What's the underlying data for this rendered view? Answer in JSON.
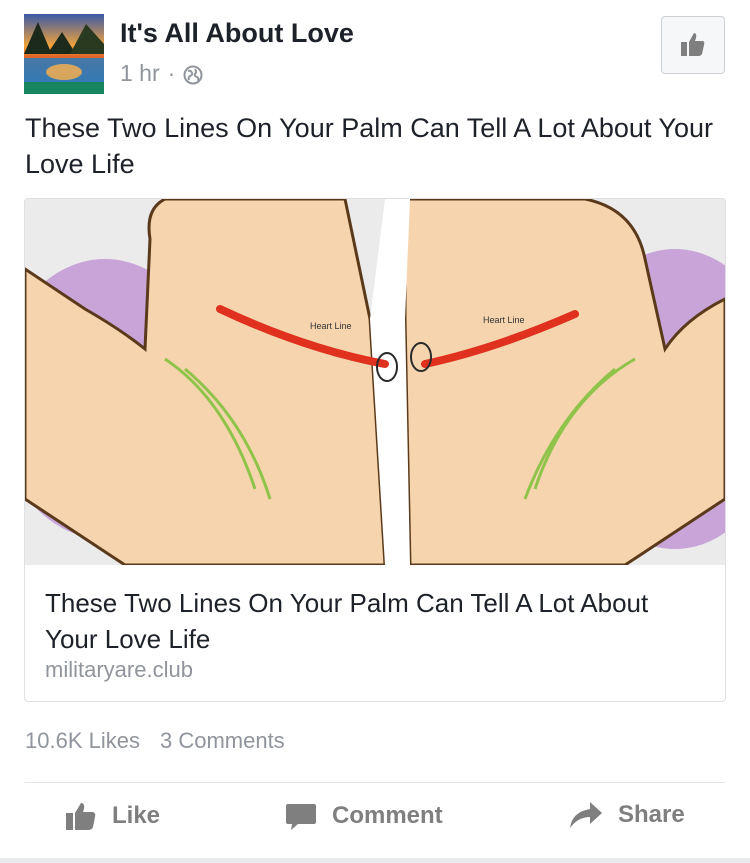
{
  "post": {
    "page_name": "It's All About Love",
    "time": "1 hr",
    "separator": "·",
    "privacy_icon": "globe-icon",
    "message": "These Two Lines On Your Palm Can Tell A Lot About Your Love Life"
  },
  "link": {
    "title": "These Two Lines On Your Palm Can Tell A Lot About Your Love Life",
    "domain": "militaryare.club",
    "image_labels": {
      "left": "Heart Line",
      "right": "Heart Line"
    }
  },
  "stats": {
    "likes": "10.6K Likes",
    "comments": "3 Comments"
  },
  "actions": {
    "like": "Like",
    "comment": "Comment",
    "share": "Share"
  },
  "colors": {
    "text": "#1d2129",
    "secondary": "#90949c",
    "action": "#7f7f7f"
  }
}
